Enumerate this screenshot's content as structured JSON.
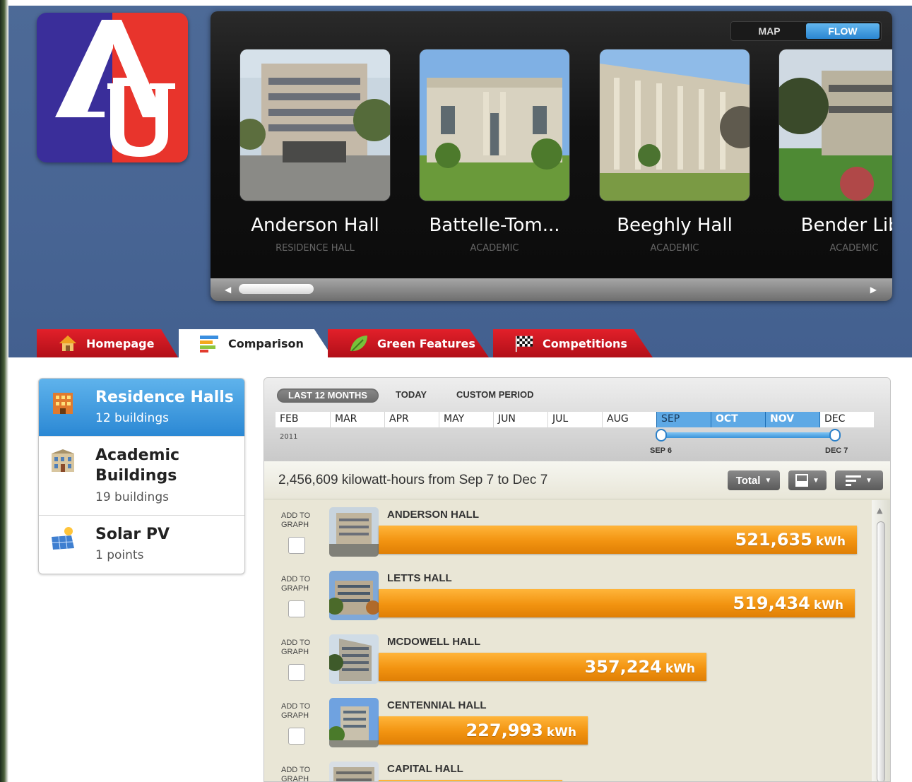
{
  "view_toggle": {
    "map": "MAP",
    "flow": "FLOW",
    "selected": "FLOW"
  },
  "carousel": [
    {
      "name": "Anderson Hall",
      "type": "RESIDENCE HALL"
    },
    {
      "name": "Battelle-Tom...",
      "type": "ACADEMIC"
    },
    {
      "name": "Beeghly Hall",
      "type": "ACADEMIC"
    },
    {
      "name": "Bender Libr",
      "type": "ACADEMIC"
    }
  ],
  "tabs": [
    {
      "label": "Homepage"
    },
    {
      "label": "Comparison"
    },
    {
      "label": "Green Features"
    },
    {
      "label": "Competitions"
    }
  ],
  "sidebar": [
    {
      "title": "Residence Halls",
      "count": "12 buildings"
    },
    {
      "title": "Academic Buildings",
      "count": "19 buildings"
    },
    {
      "title": "Solar PV",
      "count": "1 points"
    }
  ],
  "periods": {
    "last12": "LAST 12 MONTHS",
    "today": "TODAY",
    "custom": "CUSTOM PERIOD"
  },
  "months": [
    "FEB",
    "MAR",
    "APR",
    "MAY",
    "JUN",
    "JUL",
    "AUG",
    "SEP",
    "OCT",
    "NOV",
    "DEC"
  ],
  "year": "2011",
  "range": {
    "start": "SEP 6",
    "end": "DEC 7"
  },
  "summary": "2,456,609 kilowatt-hours from Sep 7 to Dec 7",
  "controls": {
    "total": "Total"
  },
  "add_label_1": "ADD TO",
  "add_label_2": "GRAPH",
  "unit": "kWh",
  "buildings": [
    {
      "name": "ANDERSON HALL",
      "value": "521,635",
      "kwh": 521635
    },
    {
      "name": "LETTS HALL",
      "value": "519,434",
      "kwh": 519434
    },
    {
      "name": "MCDOWELL HALL",
      "value": "357,224",
      "kwh": 357224
    },
    {
      "name": "CENTENNIAL HALL",
      "value": "227,993",
      "kwh": 227993
    },
    {
      "name": "CAPITAL HALL",
      "value": "",
      "kwh": 200000
    }
  ]
}
